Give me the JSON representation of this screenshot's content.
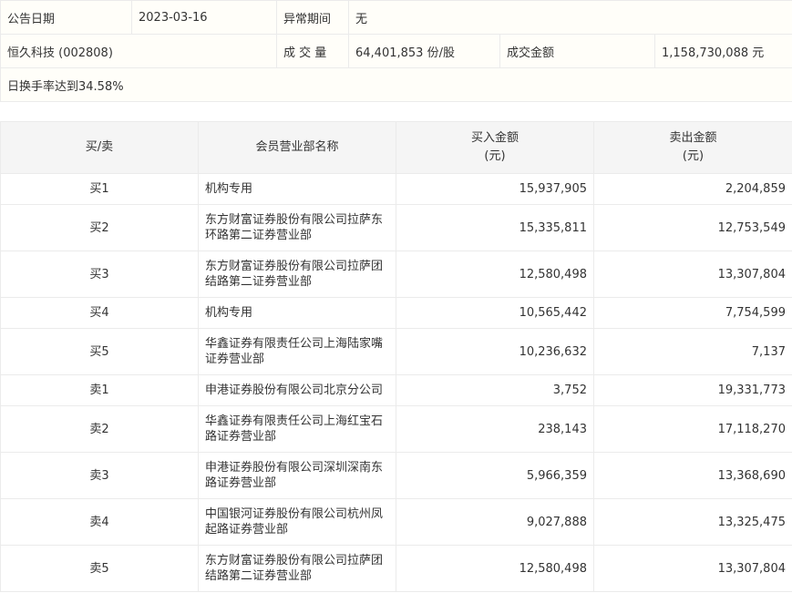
{
  "info": {
    "announce_date_label": "公告日期",
    "announce_date": "2023-03-16",
    "abnormal_period_label": "异常期间",
    "abnormal_period": "无",
    "stock": "恒久科技 (002808)",
    "volume_label": "成 交 量",
    "volume": "64,401,853 份/股",
    "amount_label": "成交金额",
    "amount": "1,158,730,088 元",
    "reason": "日换手率达到34.58%"
  },
  "table": {
    "headers": [
      "买/卖",
      "会员营业部名称",
      "买入金额\n(元)",
      "卖出金额\n(元)"
    ],
    "rows": [
      {
        "side": "买1",
        "name": "机构专用",
        "buy": "15,937,905",
        "sell": "2,204,859"
      },
      {
        "side": "买2",
        "name": "东方财富证券股份有限公司拉萨东环路第二证券营业部",
        "buy": "15,335,811",
        "sell": "12,753,549"
      },
      {
        "side": "买3",
        "name": "东方财富证券股份有限公司拉萨团结路第二证券营业部",
        "buy": "12,580,498",
        "sell": "13,307,804"
      },
      {
        "side": "买4",
        "name": "机构专用",
        "buy": "10,565,442",
        "sell": "7,754,599"
      },
      {
        "side": "买5",
        "name": "华鑫证券有限责任公司上海陆家嘴证券营业部",
        "buy": "10,236,632",
        "sell": "7,137"
      },
      {
        "side": "卖1",
        "name": "申港证券股份有限公司北京分公司",
        "buy": "3,752",
        "sell": "19,331,773"
      },
      {
        "side": "卖2",
        "name": "华鑫证券有限责任公司上海红宝石路证券营业部",
        "buy": "238,143",
        "sell": "17,118,270"
      },
      {
        "side": "卖3",
        "name": "申港证券股份有限公司深圳深南东路证券营业部",
        "buy": "5,966,359",
        "sell": "13,368,690"
      },
      {
        "side": "卖4",
        "name": "中国银河证券股份有限公司杭州凤起路证券营业部",
        "buy": "9,027,888",
        "sell": "13,325,475"
      },
      {
        "side": "卖5",
        "name": "东方财富证券股份有限公司拉萨团结路第二证券营业部",
        "buy": "12,580,498",
        "sell": "13,307,804"
      }
    ]
  }
}
